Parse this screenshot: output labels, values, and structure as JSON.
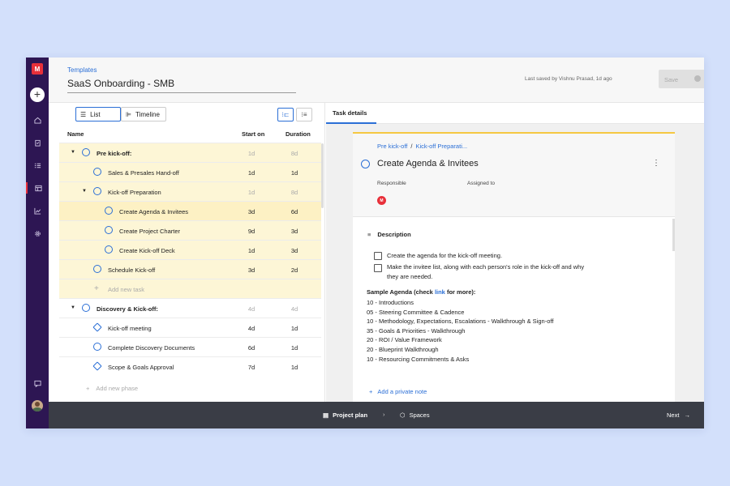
{
  "rail": {
    "logo": "M",
    "nav": [
      "home-icon",
      "clipboard-icon",
      "checklist-icon",
      "templates-icon",
      "analytics-icon",
      "settings-icon"
    ]
  },
  "header": {
    "breadcrumb": "Templates",
    "title": "SaaS Onboarding - SMB",
    "saved_text": "Last saved by Vishnu Prasad, 1d ago",
    "save_label": "Save"
  },
  "toolbar": {
    "list_label": "List",
    "timeline_label": "Timeline"
  },
  "columns": {
    "name": "Name",
    "start": "Start on",
    "duration": "Duration"
  },
  "rows": [
    {
      "name": "Pre kick-off:",
      "start": "1d",
      "duration": "8d"
    },
    {
      "name": "Sales & Presales Hand-off",
      "start": "1d",
      "duration": "1d"
    },
    {
      "name": "Kick-off Preparation",
      "start": "1d",
      "duration": "8d"
    },
    {
      "name": "Create Agenda & Invitees",
      "start": "3d",
      "duration": "6d"
    },
    {
      "name": "Create Project Charter",
      "start": "9d",
      "duration": "3d"
    },
    {
      "name": "Create Kick-off Deck",
      "start": "1d",
      "duration": "3d"
    },
    {
      "name": "Schedule Kick-off",
      "start": "3d",
      "duration": "2d"
    },
    {
      "name": "Add new task"
    },
    {
      "name": "Discovery & Kick-off:",
      "start": "4d",
      "duration": "4d"
    },
    {
      "name": "Kick-off meeting",
      "start": "4d",
      "duration": "1d"
    },
    {
      "name": "Complete Discovery Documents",
      "start": "6d",
      "duration": "1d"
    },
    {
      "name": "Scope & Goals Approval",
      "start": "7d",
      "duration": "1d"
    }
  ],
  "add_phase": "Add new phase",
  "details": {
    "tab": "Task details",
    "breadcrumb_1": "Pre kick-off",
    "breadcrumb_sep": "/",
    "breadcrumb_2": "Kick-off Preparati...",
    "task_name": "Create Agenda & Invitees",
    "responsible_label": "Responsible",
    "assigned_label": "Assigned to",
    "description_label": "Description",
    "check_1": "Create the agenda for the kick-off meeting.",
    "check_2a": "Make the invitee list, along with each person's role in the kick-off and why",
    "check_2b": "they are needed.",
    "sample_prefix": "Sample Agenda (check",
    "sample_link": "link",
    "sample_suffix": "for more):",
    "agenda": [
      "10 - Introductions",
      "05 - Steering Committee & Cadence",
      "10 - Methodology, Expectations, Escalations - Walkthrough & Sign-off",
      "35 - Goals & Priorities - Walkthrough",
      "20 - ROI / Value Framework",
      "20 - Blueprint Walkthrough",
      "10 - Resourcing Commitments & Asks"
    ],
    "private_note": "Add a private note"
  },
  "footer": {
    "project_plan": "Project plan",
    "spaces": "Spaces",
    "next": "Next"
  },
  "colors": {
    "accent": "#2b6fd6",
    "rail": "#2d1653",
    "brand": "#e8303a",
    "highlight": "#fdf6d6"
  }
}
